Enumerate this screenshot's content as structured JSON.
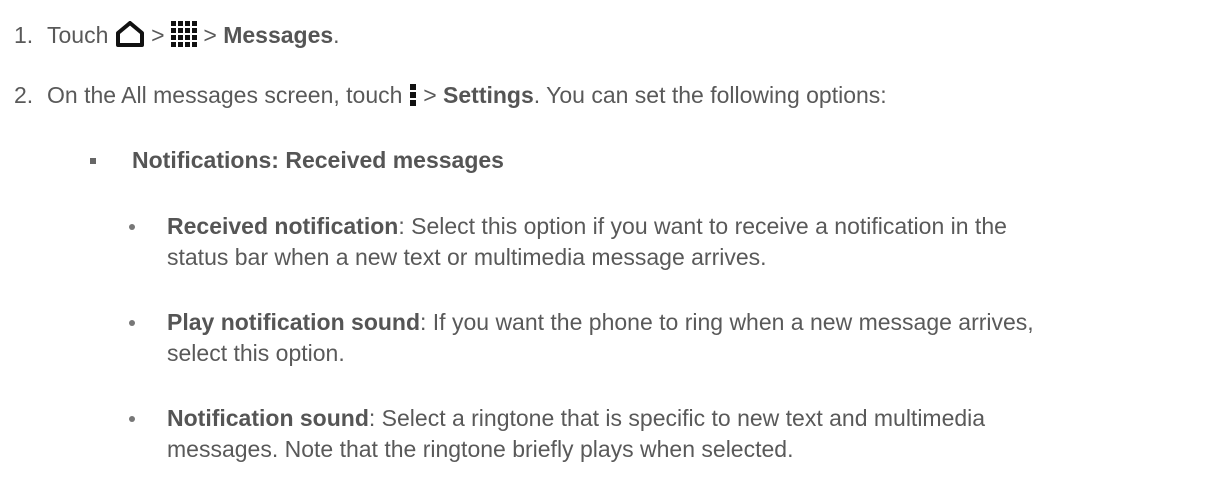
{
  "steps": [
    {
      "number": "1.",
      "pre": "Touch ",
      "icon1": "home-icon",
      "sep1": " > ",
      "icon2": "apps-grid-icon",
      "sep2": " > ",
      "bold": "Messages",
      "post": "."
    },
    {
      "number": "2.",
      "pre": "On the All messages screen, touch ",
      "icon": "menu-icon",
      "sep": " > ",
      "bold": "Settings",
      "post": ". You can set the following options:"
    }
  ],
  "section": {
    "heading": "Notifications: Received messages",
    "items": [
      {
        "term": "Received notification",
        "desc": ": Select this option if you want to receive a notification in the status bar when a new text or multimedia message arrives."
      },
      {
        "term": "Play notification sound",
        "desc": ": If you want the phone to ring when a new message arrives, select this option."
      },
      {
        "term": "Notification sound",
        "desc": ": Select a ringtone that is specific to new text and multimedia messages. Note that the ringtone briefly plays when selected."
      }
    ]
  }
}
